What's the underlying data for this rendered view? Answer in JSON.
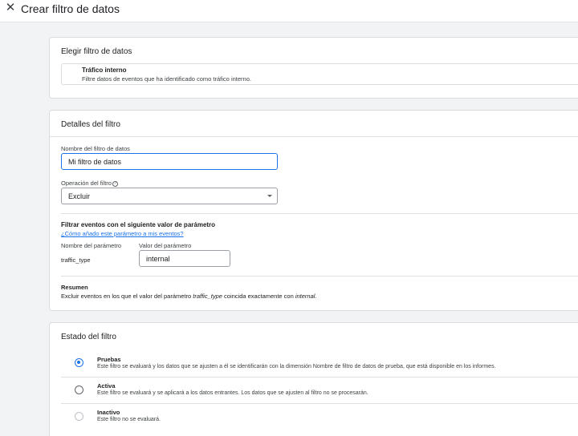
{
  "header": {
    "title": "Crear filtro de datos"
  },
  "choose_filter": {
    "title": "Elegir filtro de datos",
    "option_title": "Tráfico interno",
    "option_desc": "Filtre datos de eventos que ha identificado como tráfico interno."
  },
  "details": {
    "title": "Detalles del filtro",
    "name_label": "Nombre del filtro de datos",
    "name_value": "Mi filtro de datos",
    "operation_label": "Operación del filtro",
    "operation_value": "Excluir",
    "params_title": "Filtrar eventos con el siguiente valor de parámetro",
    "params_link": "¿Cómo añado este parámetro a mis eventos?",
    "param_name_header": "Nombre del parámetro",
    "param_value_header": "Valor del parámetro",
    "param_name": "traffic_type",
    "param_value": "internal",
    "summary_title": "Resumen",
    "summary_pre": "Excluir eventos en los que el valor del parámetro ",
    "summary_param": "traffic_type",
    "summary_mid": " coincida exactamente con ",
    "summary_value": "internal",
    "summary_end": "."
  },
  "state": {
    "title": "Estado del filtro",
    "options": [
      {
        "title": "Pruebas",
        "desc": "Este filtro se evaluará y los datos que se ajusten a él se identificarán con la dimensión Nombre de filtro de datos de prueba, que está disponible en los informes.",
        "selected": true
      },
      {
        "title": "Activa",
        "desc": "Este filtro se evaluará y se aplicará a los datos entrantes. Los datos que se ajusten al filtro no se procesarán.",
        "selected": false
      },
      {
        "title": "Inactivo",
        "desc": "Este filtro no se evaluará.",
        "selected": false
      }
    ]
  },
  "colors": {
    "accent": "#1a73e8",
    "background": "#f1f3f4"
  }
}
